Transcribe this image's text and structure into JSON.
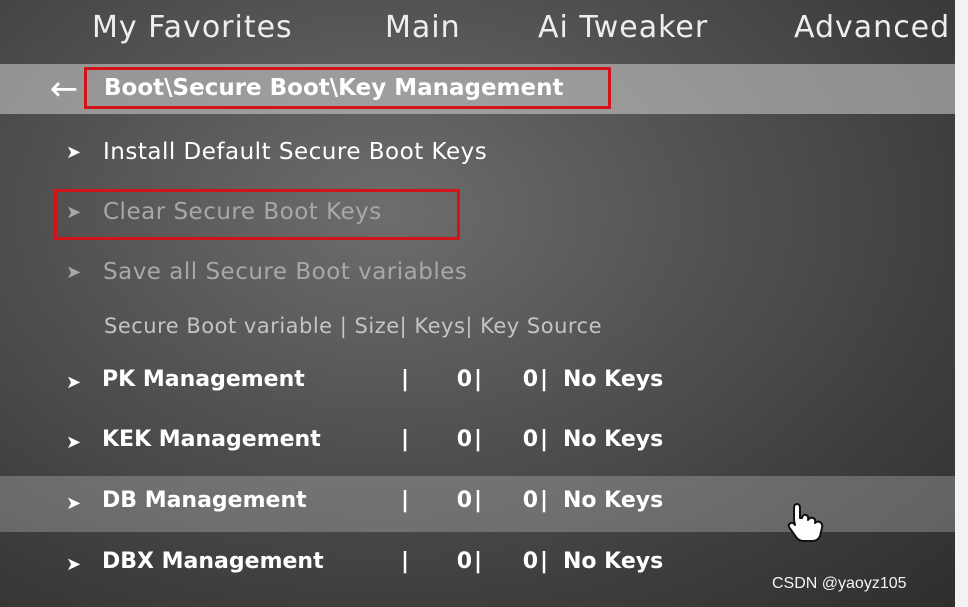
{
  "tabs": [
    "My Favorites",
    "Main",
    "Ai Tweaker",
    "Advanced"
  ],
  "breadcrumb": "Boot\\Secure Boot\\Key Management",
  "menu": [
    {
      "label": "Install Default Secure Boot Keys",
      "enabled": true
    },
    {
      "label": "Clear Secure Boot Keys",
      "enabled": false
    },
    {
      "label": "Save all Secure Boot variables",
      "enabled": false
    }
  ],
  "table": {
    "header": "Secure Boot variable  |  Size|  Keys|  Key Source",
    "rows": [
      {
        "name": "PK Management",
        "size": "0",
        "keys": "0",
        "source": "No Keys"
      },
      {
        "name": "KEK Management",
        "size": "0",
        "keys": "0",
        "source": "No Keys"
      },
      {
        "name": "DB Management",
        "size": "0",
        "keys": "0",
        "source": "No Keys",
        "selected": true
      },
      {
        "name": "DBX Management",
        "size": "0",
        "keys": "0",
        "source": "No Keys"
      }
    ]
  },
  "watermark": "CSDN @yaoyz105",
  "icons": {
    "back": "left-arrow-icon",
    "chevron": "chevron-right-icon",
    "cursor": "hand-pointer-icon"
  },
  "colors": {
    "highlight_box": "#d0141a",
    "text": "#ffffff",
    "disabled_text": "#a8a8a6"
  }
}
